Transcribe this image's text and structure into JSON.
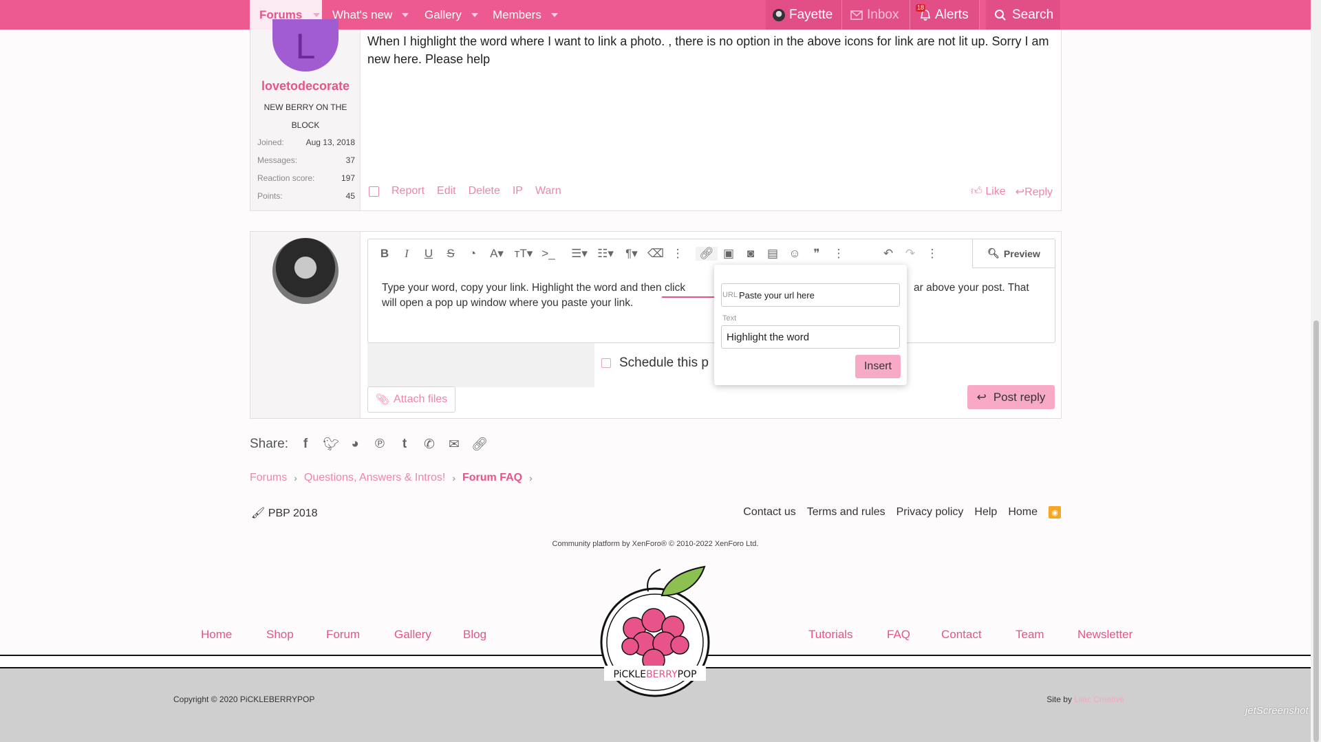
{
  "nav": {
    "items": [
      {
        "label": "Forums"
      },
      {
        "label": "What's new"
      },
      {
        "label": "Gallery"
      },
      {
        "label": "Members"
      }
    ],
    "user": "Fayette",
    "inbox": "Inbox",
    "alerts": "Alerts",
    "alerts_badge": "18",
    "search": "Search"
  },
  "post": {
    "username": "lovetodecorate",
    "avatar_letter": "L",
    "user_title": "NEW BERRY ON THE BLOCK",
    "stats": [
      {
        "label": "Joined:",
        "value": "Aug 13, 2018"
      },
      {
        "label": "Messages:",
        "value": "37"
      },
      {
        "label": "Reaction score:",
        "value": "197"
      },
      {
        "label": "Points:",
        "value": "45"
      }
    ],
    "message": "When I highlight the word where I want to link a photo. , there is no option in the above icons for link are not lit up. Sorry I am new here. Please help",
    "actions": [
      "Report",
      "Edit",
      "Delete",
      "IP",
      "Warn"
    ],
    "like": "Like",
    "reply": "Reply"
  },
  "editor": {
    "preview": "Preview",
    "text_line1": "Type your word, copy your link. Highlight the word and then click",
    "text_line1_end": "ar above your post.  That",
    "text_line2": "will open a pop up window where you paste your link.",
    "schedule": "Schedule this p",
    "attach": "Attach files",
    "post_reply": "Post reply"
  },
  "popup": {
    "url_label": "URL",
    "url_placeholder": "Paste your url here",
    "text_label": "Text",
    "text_value": "Highlight the word",
    "insert": "Insert"
  },
  "share": {
    "label": "Share:"
  },
  "breadcrumbs": [
    "Forums",
    "Questions, Answers & Intros!",
    "Forum FAQ"
  ],
  "footer": {
    "style": "PBP 2018",
    "links": [
      "Contact us",
      "Terms and rules",
      "Privacy policy",
      "Help",
      "Home"
    ],
    "xenforo": "Community platform by XenForo® © 2010-2022 XenForo Ltd."
  },
  "site_footer": {
    "left_nav": [
      "Home",
      "Shop",
      "Forum",
      "Gallery",
      "Blog"
    ],
    "right_nav": [
      "Tutorials",
      "FAQ",
      "Contact",
      "Team",
      "Newsletter"
    ],
    "logo_text_a": "PiCKLE",
    "logo_text_b": "BERRY",
    "logo_text_c": "POP",
    "copyright": "Copyright © 2020 PiCKLEBERRYPOP",
    "site_by": "Site by",
    "site_by_name": "Lilac Creative"
  },
  "watermark": "jetScreenshot",
  "colors": {
    "brand": "#ec5a8f",
    "accent": "#e8538a",
    "button": "#f7a9c6"
  }
}
